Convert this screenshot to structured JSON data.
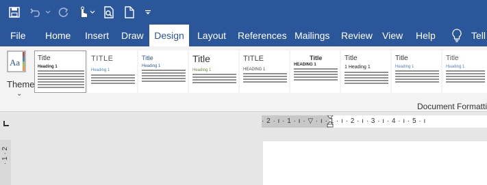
{
  "quick_access": {
    "icons": [
      "save-icon",
      "undo-icon",
      "redo-icon",
      "touch-mode-icon",
      "print-preview-icon",
      "new-document-icon",
      "customize-qat-icon"
    ]
  },
  "tabs": [
    {
      "label": "File"
    },
    {
      "label": "Home"
    },
    {
      "label": "Insert"
    },
    {
      "label": "Draw"
    },
    {
      "label": "Design",
      "active": true
    },
    {
      "label": "Layout"
    },
    {
      "label": "References"
    },
    {
      "label": "Mailings"
    },
    {
      "label": "Review"
    },
    {
      "label": "View"
    },
    {
      "label": "Help"
    },
    {
      "label": "Tell"
    }
  ],
  "ribbon": {
    "themes_label": "Themes",
    "group_label": "Document Formatti",
    "style_sets": [
      {
        "title": "Title",
        "heading": "Heading 1"
      },
      {
        "title": "TITLE",
        "heading": "Heading 1"
      },
      {
        "title": "Title",
        "heading": "Heading 1"
      },
      {
        "title": "Title",
        "heading": "Heading 1"
      },
      {
        "title": "TITLE",
        "heading": "HEADING 1"
      },
      {
        "title": "Title",
        "heading": "HEADING 1"
      },
      {
        "title": "Title",
        "heading": "1   Heading 1"
      },
      {
        "title": "Title",
        "heading": "Heading 1"
      },
      {
        "title": "Title",
        "heading": "Heading 1"
      }
    ]
  },
  "ruler": {
    "text": "· 2 · ı · 1 · ı · ▽ · ı · 1 · ı · 2 · ı · 3 · ı · 4 · ı · 5 · ı",
    "vertical_text": "· 1 · 2"
  },
  "colors": {
    "accent": "#2b579a",
    "ribbon_bg": "#f3f3f3",
    "workspace_bg": "#e6e6e6"
  }
}
